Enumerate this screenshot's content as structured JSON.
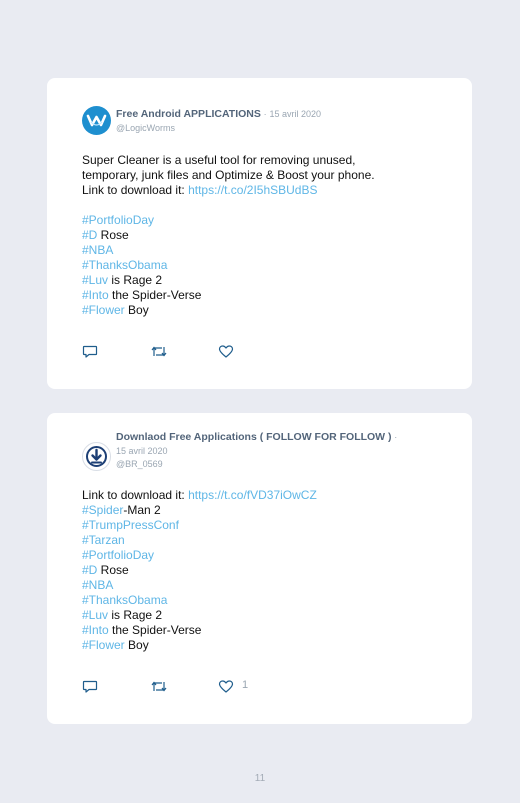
{
  "tweets": [
    {
      "author": "Free Android APPLICATIONS",
      "separator": "·",
      "date": "15 avril 2020",
      "handle": "@LogicWorms",
      "avatar_icon": "logicworms-logo-icon",
      "text_lines": [
        "Super Cleaner is a useful tool for removing unused,",
        "temporary, junk files and Optimize & Boost your phone."
      ],
      "link_prefix": "Link to download it: ",
      "link": "https://t.co/2I5hSBUdBS",
      "tags": [
        {
          "tag": "#PortfolioDay",
          "rest": ""
        },
        {
          "tag": "#D",
          "rest": " Rose"
        },
        {
          "tag": "#NBA",
          "rest": ""
        },
        {
          "tag": "#ThanksObama",
          "rest": ""
        },
        {
          "tag": "#Luv",
          "rest": " is Rage 2"
        },
        {
          "tag": "#Into",
          "rest": " the Spider-Verse"
        },
        {
          "tag": "#Flower",
          "rest": " Boy"
        }
      ],
      "like_count": ""
    },
    {
      "author": "Downlaod Free Applications ( FOLLOW FOR FOLLOW )",
      "separator": "·",
      "date": "15 avril 2020",
      "handle": "@BR_0569",
      "avatar_icon": "download-icon",
      "link_prefix": "Link to download it: ",
      "link": "https://t.co/fVD37iOwCZ",
      "tags": [
        {
          "tag": "#Spider",
          "rest": "-Man 2"
        },
        {
          "tag": "#TrumpPressConf",
          "rest": ""
        },
        {
          "tag": "#Tarzan",
          "rest": ""
        },
        {
          "tag": "#PortfolioDay",
          "rest": ""
        },
        {
          "tag": "#D",
          "rest": " Rose"
        },
        {
          "tag": "#NBA",
          "rest": ""
        },
        {
          "tag": "#ThanksObama",
          "rest": ""
        },
        {
          "tag": "#Luv",
          "rest": " is Rage 2"
        },
        {
          "tag": "#Into",
          "rest": " the Spider-Verse"
        },
        {
          "tag": "#Flower",
          "rest": " Boy"
        }
      ],
      "like_count": "1"
    }
  ],
  "page_number": "11",
  "colors": {
    "background": "#e9ebf2",
    "card": "#ffffff",
    "hashtag": "#5fb6e6",
    "author": "#53657a",
    "muted": "#9aa6b2",
    "avatar_blue": "#1e8fcf",
    "download_blue": "#1d3f75"
  }
}
